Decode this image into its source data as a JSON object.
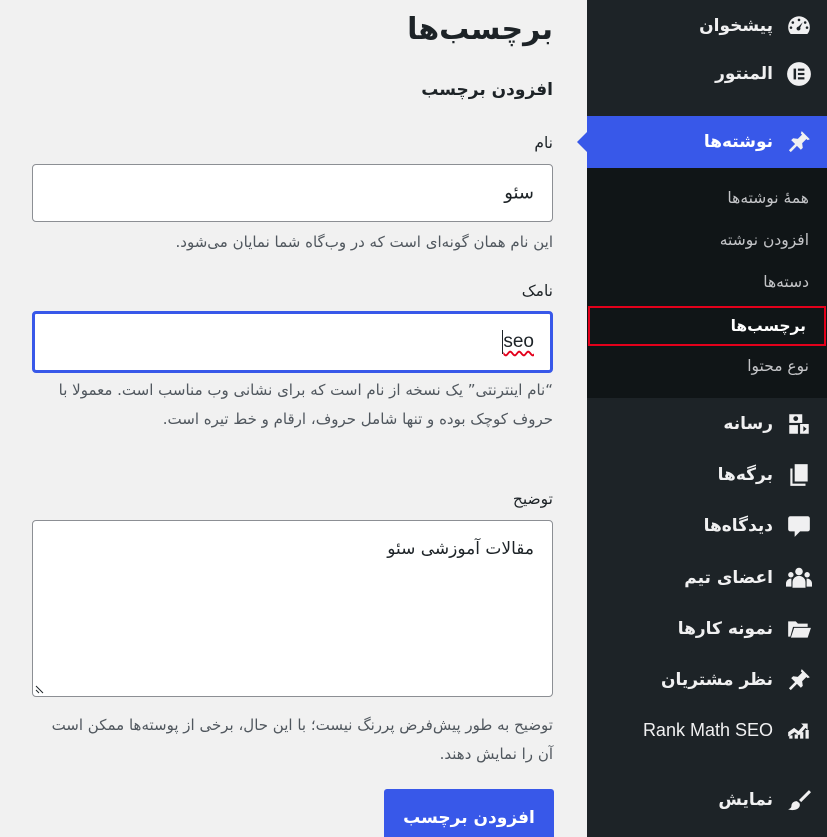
{
  "sidebar": {
    "top_items": [
      {
        "label": "پیشخوان",
        "icon": "dashboard-icon"
      },
      {
        "label": "المنتور",
        "icon": "elementor-icon"
      }
    ],
    "posts": {
      "label": "نوشته‌ها",
      "icon": "pin-icon"
    },
    "submenu": [
      {
        "label": "همهٔ نوشته‌ها"
      },
      {
        "label": "افزودن نوشته"
      },
      {
        "label": "دسته‌ها"
      },
      {
        "label": "برچسب‌ها"
      },
      {
        "label": "نوع محتوا"
      }
    ],
    "bottom_items": [
      {
        "label": "رسانه",
        "icon": "media-icon"
      },
      {
        "label": "برگه‌ها",
        "icon": "pages-icon"
      },
      {
        "label": "دیدگاه‌ها",
        "icon": "comments-icon"
      },
      {
        "label": "اعضای تیم",
        "icon": "team-icon"
      },
      {
        "label": "نمونه کارها",
        "icon": "folder-icon"
      },
      {
        "label": "نظر مشتریان",
        "icon": "pin-icon"
      },
      {
        "label": "Rank Math SEO",
        "icon": "rank-math-icon"
      },
      {
        "label": "نمایش",
        "icon": "brush-icon"
      }
    ]
  },
  "main": {
    "title": "برچسب‌ها",
    "section_title": "افزودن برچسب",
    "name_field": {
      "label": "نام",
      "value": "سئو",
      "help": "این نام همان گونه‌ای است که در وب‌گاه شما نمایان می‌شود."
    },
    "slug_field": {
      "label": "نامک",
      "value": "seo",
      "help": "“نام اینترنتی” یک نسخه از نام است که برای نشانی وب مناسب است. معمولا با حروف کوچک بوده و تنها شامل حروف، ارقام و خط تیره است."
    },
    "description_field": {
      "label": "توضیح",
      "value": "مقالات آموزشی سئو",
      "help": "توضیح به طور پیش‌فرض پررنگ نیست؛ با این حال، برخی از پوسته‌ها ممکن است آن را نمایش دهند."
    },
    "submit_label": "افزودن برچسب"
  },
  "colors": {
    "sidebar_bg": "#1d2327",
    "submenu_bg": "#101517",
    "accent": "#3858e9",
    "highlight_border": "#e3001b"
  }
}
